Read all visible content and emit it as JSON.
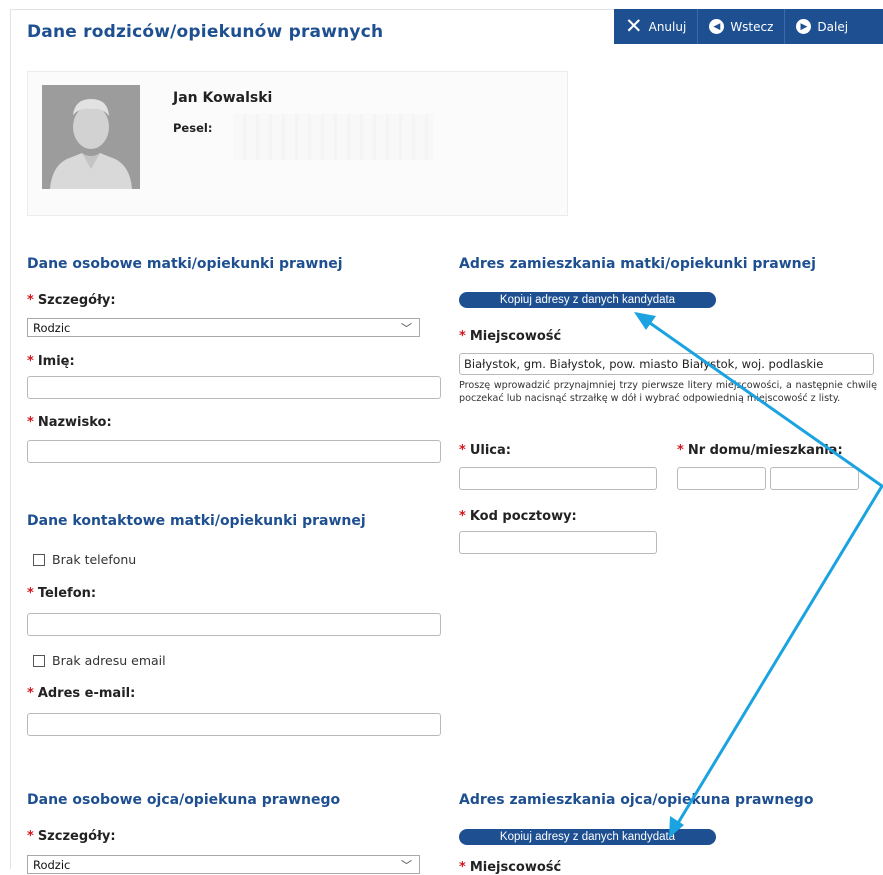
{
  "toolbar": {
    "cancel_label": "Anuluj",
    "back_label": "Wstecz",
    "next_label": "Dalej"
  },
  "page_title": "Dane rodziców/opiekunów prawnych",
  "profile": {
    "name": "Jan Kowalski",
    "pesel_label": "Pesel:"
  },
  "mother": {
    "personal_title": "Dane osobowe matki/opiekunki prawnej",
    "details_label": "Szczegóły:",
    "details_value": "Rodzic",
    "first_name_label": "Imię:",
    "first_name_value": "",
    "last_name_label": "Nazwisko:",
    "last_name_value": "",
    "contact_title": "Dane kontaktowe matki/opiekunki prawnej",
    "no_phone_label": "Brak telefonu",
    "phone_label": "Telefon:",
    "phone_value": "",
    "no_email_label": "Brak adresu email",
    "email_label": "Adres e-mail:",
    "email_value": "",
    "address_title": "Adres zamieszkania matki/opiekunki prawnej",
    "copy_button": "Kopiuj adresy z danych kandydata",
    "city_label": "Miejscowość",
    "city_value": "Białystok, gm. Białystok, pow. miasto Białystok, woj. podlaskie",
    "city_hint": "Proszę wprowadzić przynajmniej trzy pierwsze litery miejscowości, a następnie chwilę poczekać lub nacisnąć strzałkę w dół i wybrać odpowiednią miejscowość z listy.",
    "street_label": "Ulica:",
    "house_label": "Nr domu/mieszkania:",
    "postal_label": "Kod pocztowy:"
  },
  "father": {
    "personal_title": "Dane osobowe ojca/opiekuna prawnego",
    "details_label": "Szczegóły:",
    "details_value": "Rodzic",
    "address_title": "Adres zamieszkania ojca/opiekuna prawnego",
    "copy_button": "Kopiuj adresy z danych kandydata",
    "city_label": "Miejscowość"
  },
  "colors": {
    "accent": "#1d4f91",
    "required": "#d4161e",
    "annotation_arrow": "#1aa3e0"
  }
}
